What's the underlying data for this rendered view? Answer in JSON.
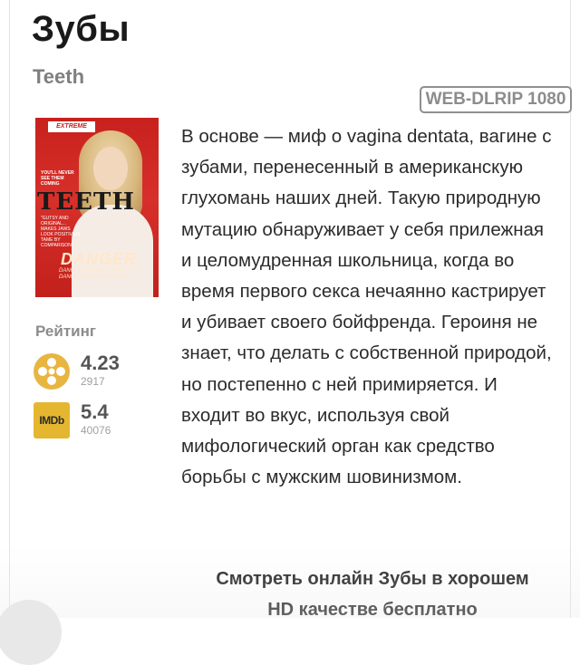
{
  "movie": {
    "title": "Зубы",
    "original_title": "Teeth",
    "quality_badge": "WEB-DLRIP 1080",
    "description": "В основе — миф о vagina dentata, вагине с зубами, перенесенный в американскую глухомань наших дней. Такую природную мутацию обнаруживает у себя прилежная и целомудренная школьница, когда во время первого секса нечаянно кастрирует и убивает своего бойфренда. Героиня не знает, что делать с собственной природой, но постепенно с ней примиряется. И входит во вкус, используя свой мифологический орган как средство борьбы с мужским шовинизмом."
  },
  "poster": {
    "top_strip": "EXTREME",
    "tagline": "YOU'LL NEVER SEE THEM COMING",
    "title_word": "TEETH",
    "quote": "\"GUTSY AND ORIGINAL... MAKES JAWS LOOK POSITIVELY TAME BY COMPARISON.\"",
    "danger_word": "DANGER",
    "danger_lines": "DANGER DANGER DANGER DANGER DANGER DANGER"
  },
  "ratings": {
    "label": "Рейтинг",
    "kinopoisk": {
      "icon": "film-reel-icon",
      "value": "4.23",
      "votes": "2917"
    },
    "imdb": {
      "icon_text": "IMDb",
      "value": "5.4",
      "votes": "40076"
    }
  },
  "watch": {
    "line1": "Смотреть онлайн Зубы в хорошем",
    "line2": "HD качестве бесплатно"
  },
  "colors": {
    "badge_border": "#8f8f8f",
    "kp_icon": "#e8b541",
    "imdb_icon": "#e5b62f",
    "poster_red": "#c8211d"
  }
}
